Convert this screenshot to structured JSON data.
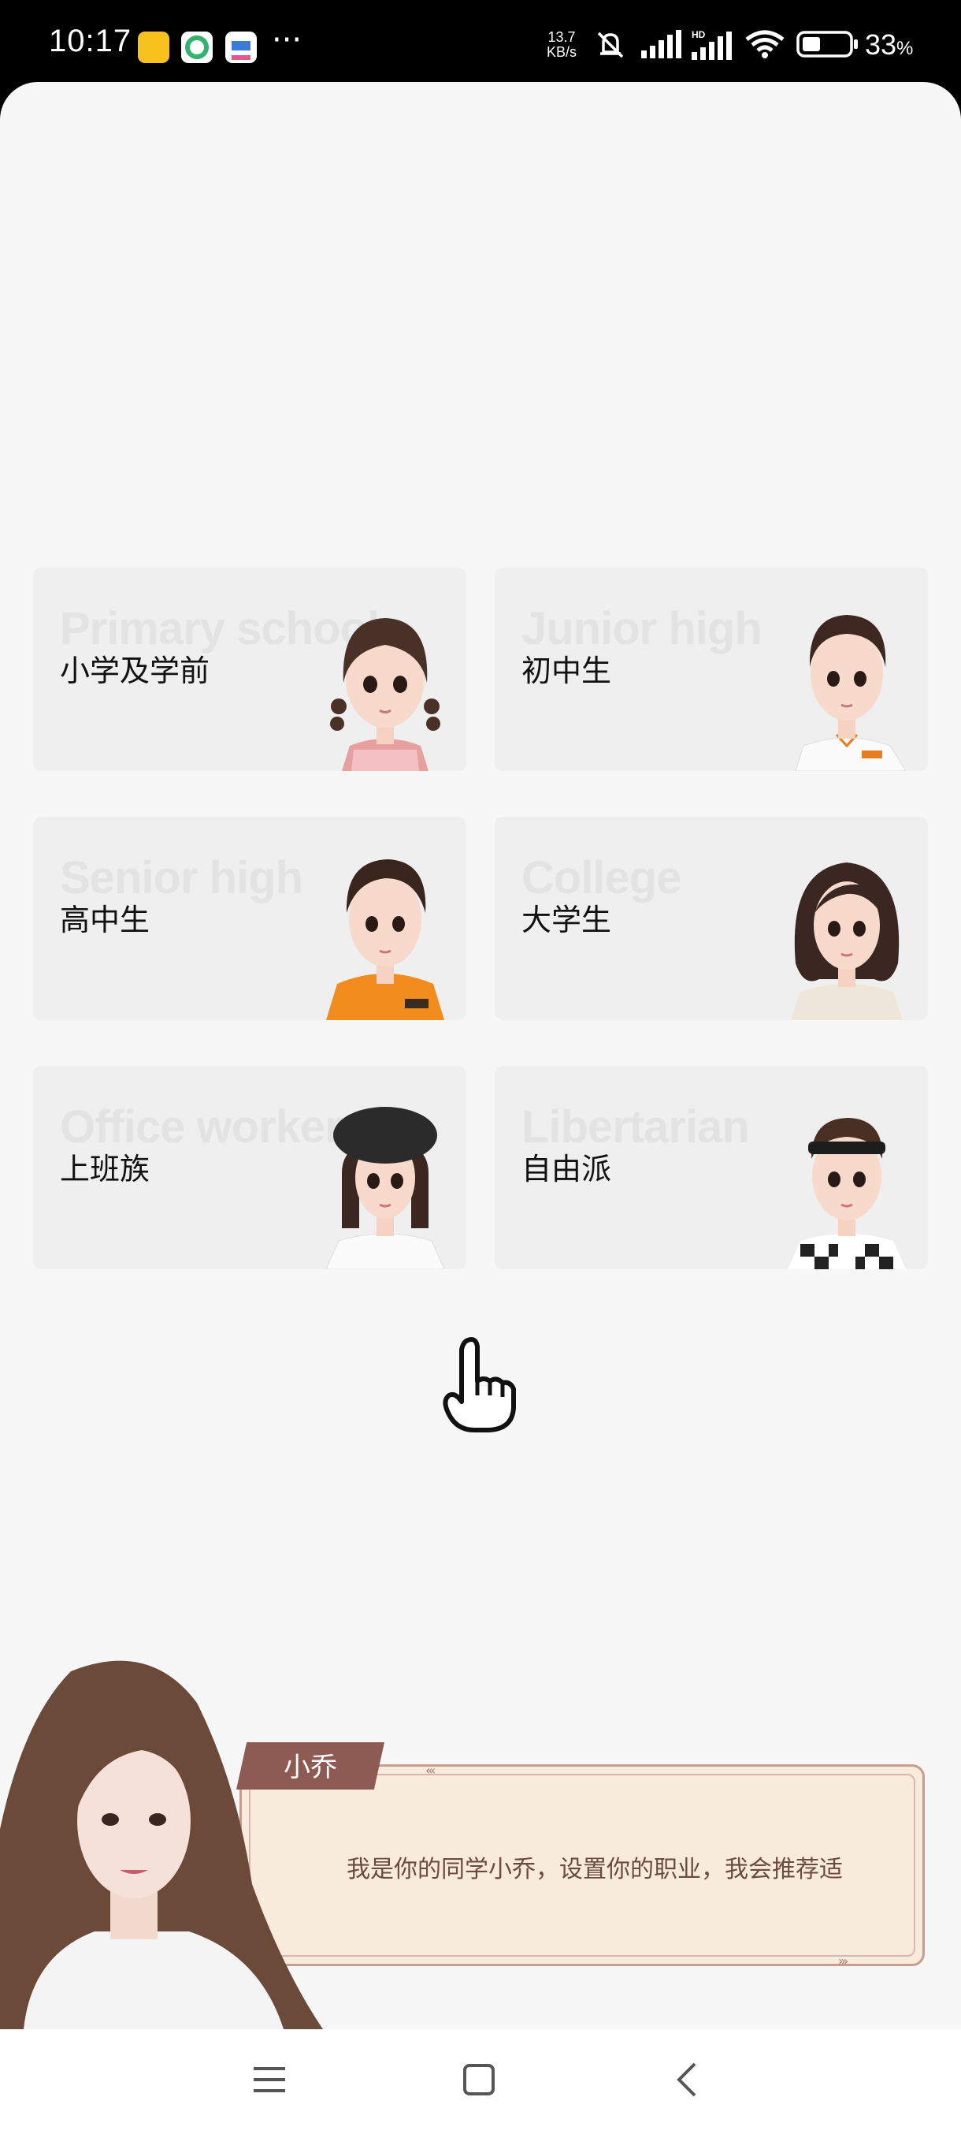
{
  "status_bar": {
    "time": "10:17",
    "more": "···",
    "net_speed_value": "13.7",
    "net_speed_unit": "KB/s",
    "battery_percent": "33",
    "battery_percent_sign": "%",
    "icons": [
      "app-icon-yellow",
      "app-icon-green",
      "app-icon-cloud",
      "mute-icon",
      "signal-icon",
      "signal-hd-icon",
      "wifi-icon",
      "battery-icon"
    ]
  },
  "cards": [
    {
      "bg": "Primary school",
      "label": "小学及学前"
    },
    {
      "bg": "Junior high",
      "label": "初中生"
    },
    {
      "bg": "Senior high",
      "label": "高中生"
    },
    {
      "bg": "College",
      "label": "大学生"
    },
    {
      "bg": "Office worker",
      "label": "上班族"
    },
    {
      "bg": "Libertarian",
      "label": "自由派"
    }
  ],
  "dialog": {
    "name": "小乔",
    "text": "我是你的同学小乔，设置你的职业，我会推荐适",
    "arrows": "‹‹‹",
    "arrows_end": "›››"
  },
  "nav": {
    "icons": [
      "menu-icon",
      "home-icon",
      "back-icon"
    ]
  },
  "colors": {
    "page_bg": "#f7f7f7",
    "card_bg": "#efefef",
    "dialog_bg": "#f9ebdc",
    "name_tag": "#8e5b54"
  }
}
